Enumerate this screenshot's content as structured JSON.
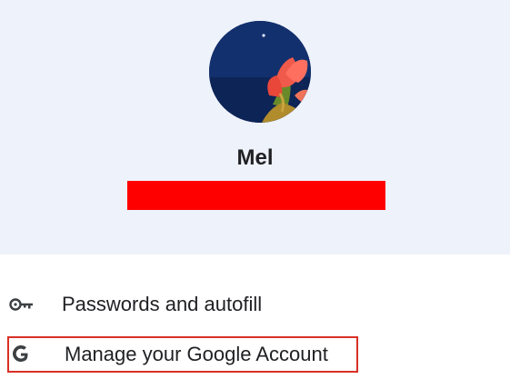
{
  "profile": {
    "name": "Mel",
    "email_redaction_color": "#ff0000"
  },
  "menu": {
    "items": [
      {
        "icon": "key-icon",
        "label": "Passwords and autofill"
      },
      {
        "icon": "google-g-icon",
        "label": "Manage your Google Account",
        "highlighted": true
      }
    ]
  },
  "colors": {
    "header_background": "#eef2fa",
    "highlight_border": "#d93025",
    "text": "#202124"
  }
}
